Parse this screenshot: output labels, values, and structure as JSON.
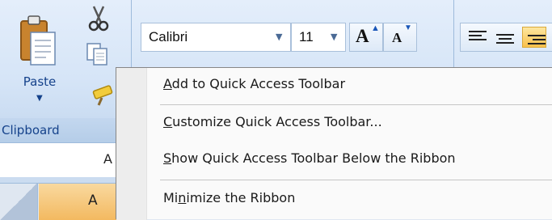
{
  "clipboard": {
    "paste_label": "Paste",
    "group_label": "Clipboard"
  },
  "font": {
    "name": "Calibri",
    "size": "11"
  },
  "sheet": {
    "namebox_text": "A",
    "column_a_label": "A"
  },
  "context_menu": {
    "items": [
      {
        "mnemonic": "A",
        "rest": "dd to Quick Access Toolbar"
      },
      {
        "mnemonic": "C",
        "rest": "ustomize Quick Access Toolbar..."
      },
      {
        "mnemonic": "S",
        "rest": "how Quick Access Toolbar Below the Ribbon"
      },
      {
        "pre": "Mi",
        "mnemonic": "n",
        "rest": "imize the Ribbon"
      }
    ]
  },
  "colors": {
    "ribbon_bg": "#d6e5f7",
    "ribbon_text": "#15428b",
    "menu_bg": "#fafafa",
    "column_highlight": "#f3b960"
  },
  "icons": [
    "paste-icon",
    "cut-icon",
    "copy-icon",
    "format-painter-icon",
    "dropdown-arrow-icon",
    "grow-font-icon",
    "shrink-font-icon",
    "align-left-icon",
    "align-center-icon",
    "align-right-icon"
  ]
}
